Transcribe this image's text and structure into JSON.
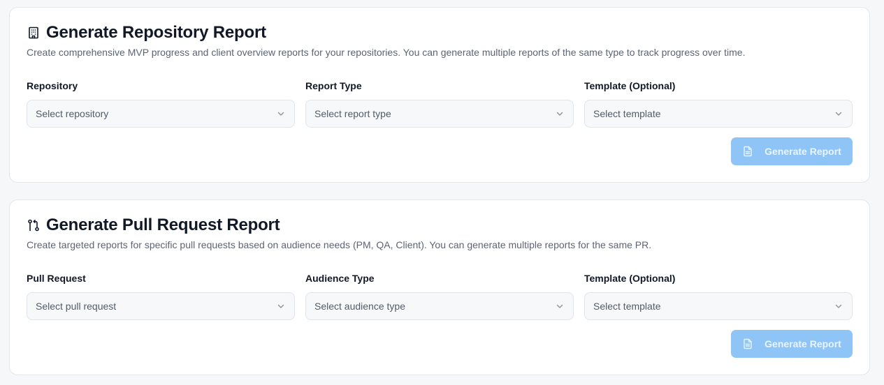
{
  "repo_report": {
    "title": "Generate Repository Report",
    "icon": "building-icon",
    "description": "Create comprehensive MVP progress and client overview reports for your repositories. You can generate multiple reports of the same type to track progress over time.",
    "fields": [
      {
        "label": "Repository",
        "placeholder": "Select repository"
      },
      {
        "label": "Report Type",
        "placeholder": "Select report type"
      },
      {
        "label": "Template (Optional)",
        "placeholder": "Select template"
      }
    ],
    "button_label": "Generate Report"
  },
  "pr_report": {
    "title": "Generate Pull Request Report",
    "icon": "git-pull-request-icon",
    "description": "Create targeted reports for specific pull requests based on audience needs (PM, QA, Client). You can generate multiple reports for the same PR.",
    "fields": [
      {
        "label": "Pull Request",
        "placeholder": "Select pull request"
      },
      {
        "label": "Audience Type",
        "placeholder": "Select audience type"
      },
      {
        "label": "Template (Optional)",
        "placeholder": "Select template"
      }
    ],
    "button_label": "Generate Report"
  },
  "colors": {
    "button_disabled_bg": "#8fc5f6",
    "card_bg": "#ffffff",
    "page_bg": "#f6f7f9"
  }
}
